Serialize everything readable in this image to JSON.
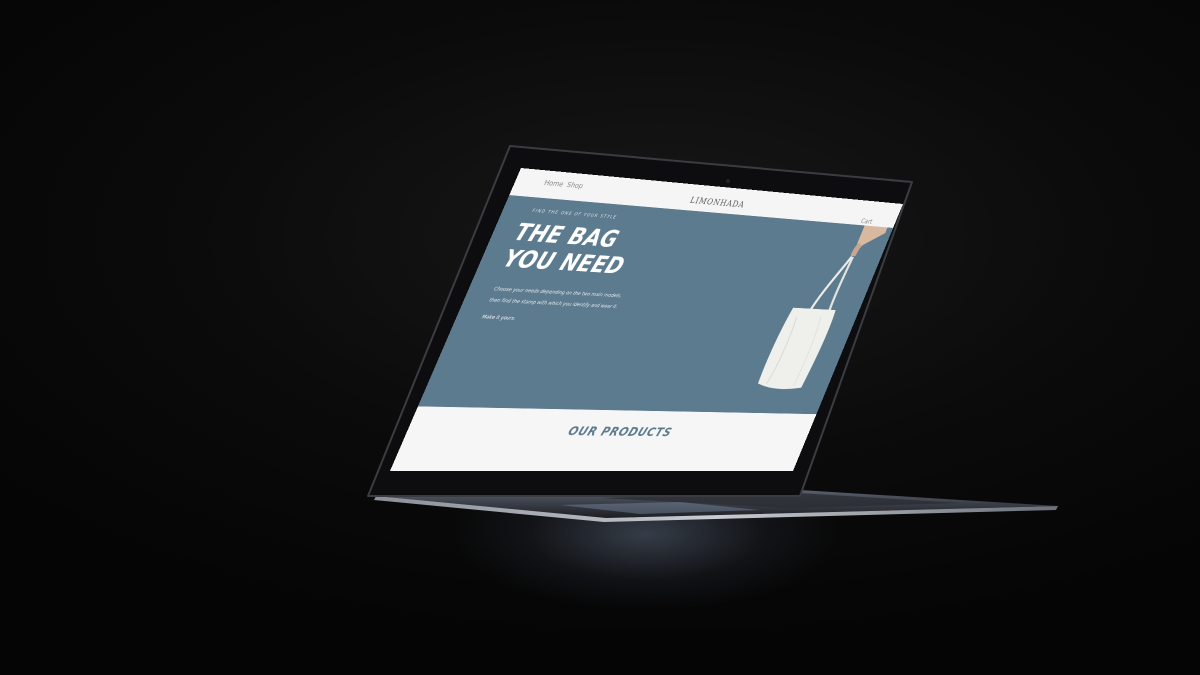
{
  "site": {
    "brand": "LIMONHADA",
    "nav": {
      "home": "Home",
      "shop": "Shop",
      "cart": "Cart"
    }
  },
  "hero": {
    "eyebrow": "FIND THE ONE OF YOUR STYLE",
    "title_line1": "THE BAG",
    "title_line2": "YOU NEED",
    "desc_line1": "Choose your needs depending on the two main models,",
    "desc_line2": "then find the stamp with which you identify and wear it.",
    "cta": "Make it yours."
  },
  "products": {
    "heading": "OUR PRODUCTS"
  },
  "colors": {
    "hero_bg": "#5d7b8f",
    "page_bg": "#f5f5f5",
    "accent": "#5d7b8f"
  },
  "icons": {
    "bag": "tote-bag-image"
  }
}
